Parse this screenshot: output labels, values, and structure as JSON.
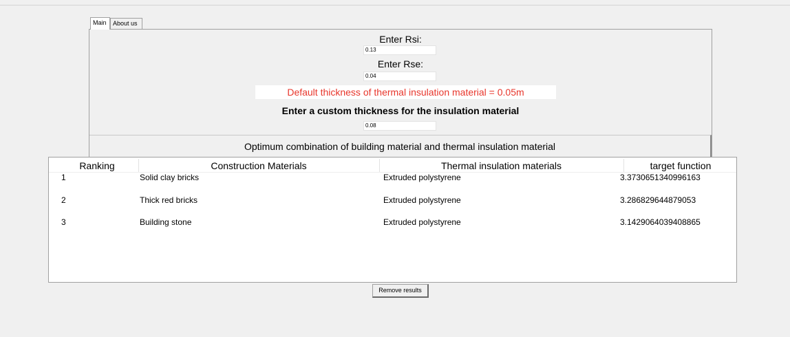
{
  "tabs": [
    {
      "label": "Main",
      "active": true
    },
    {
      "label": "About us",
      "active": false
    }
  ],
  "form": {
    "rsi_label": "Enter Rsi:",
    "rsi_value": "0.13",
    "rse_label": "Enter Rse:",
    "rse_value": "0.04",
    "default_thickness_text": "Default thickness of thermal insulation material = 0.05m",
    "custom_thickness_label": "Enter a custom thickness for the insulation material",
    "custom_thickness_value": "0.08",
    "optimum_heading": "Optimum combination of building material and thermal insulation material"
  },
  "results": {
    "columns": [
      "Ranking",
      "Construction Materials",
      "Thermal insulation materials",
      "target function"
    ],
    "rows": [
      {
        "ranking": "1",
        "construction": "Solid clay bricks",
        "insulation": "Extruded polystyrene",
        "target": "3.3730651340996163"
      },
      {
        "ranking": "2",
        "construction": "Thick red bricks",
        "insulation": "Extruded polystyrene",
        "target": "3.286829644879053"
      },
      {
        "ranking": "3",
        "construction": "Building stone",
        "insulation": "Extruded polystyrene",
        "target": "3.1429064039408865"
      }
    ]
  },
  "actions": {
    "remove_label": "Remove results"
  },
  "colors": {
    "warning_text": "#e8362b",
    "background": "#f0f0f0"
  }
}
